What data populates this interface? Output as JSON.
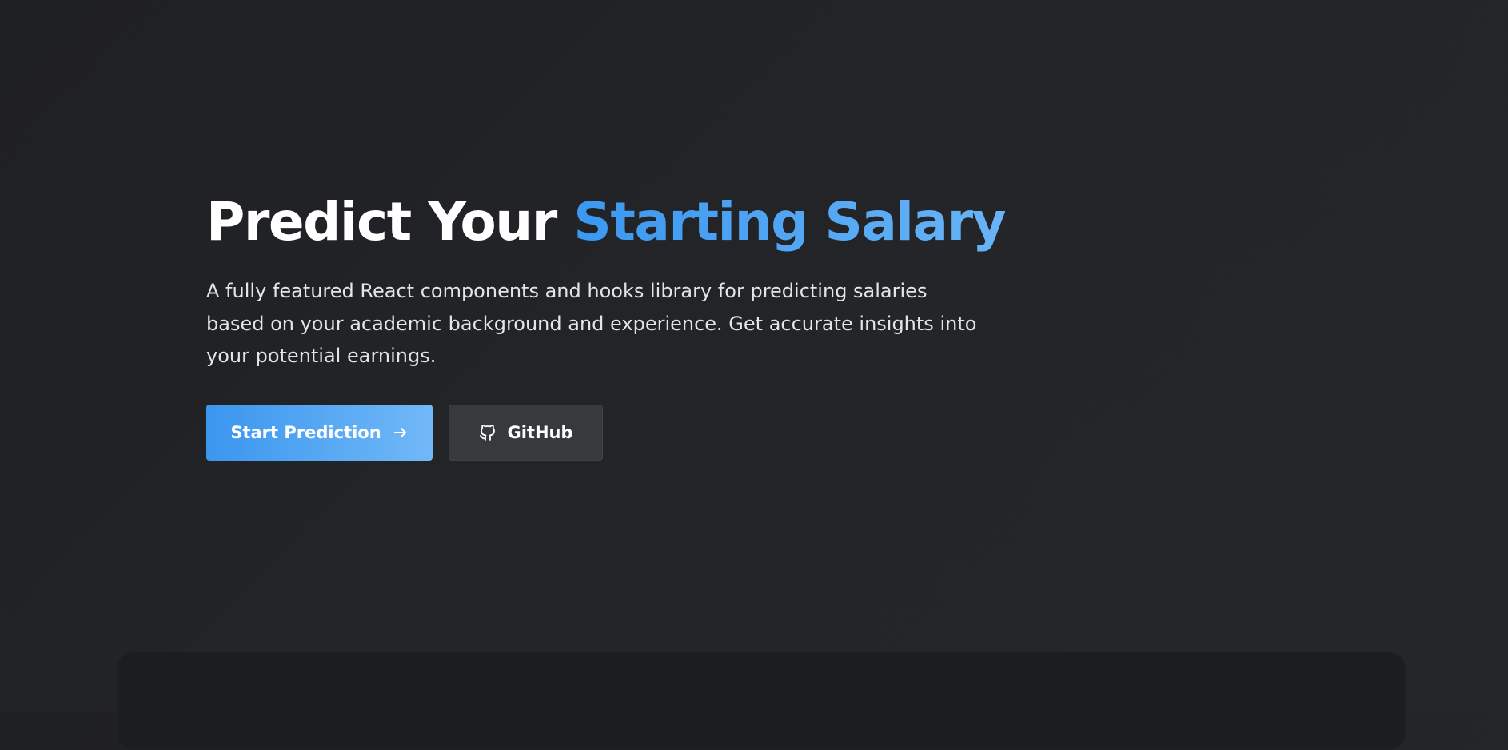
{
  "hero": {
    "title_prefix": "Predict Your",
    "title_highlight": "Starting Salary",
    "subtitle": "A fully featured React components and hooks library for predicting salaries based on your academic background and experience. Get accurate insights into your potential earnings."
  },
  "actions": {
    "primary_label": "Start Prediction",
    "primary_icon": "arrow-right-icon",
    "secondary_label": "GitHub",
    "secondary_icon": "github-icon"
  },
  "colors": {
    "background": "#222328",
    "accent_start": "#3b96ef",
    "accent_end": "#71b8f7",
    "secondary_button": "#38393d",
    "panel": "#1c1d21"
  }
}
